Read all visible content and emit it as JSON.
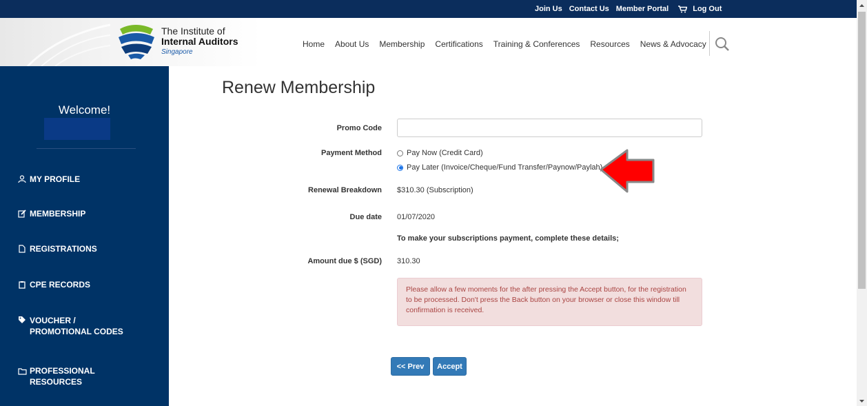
{
  "topbar": {
    "links": [
      "Join Us",
      "Contact Us",
      "Member Portal"
    ],
    "logout": "Log Out"
  },
  "logo": {
    "line1": "The Institute of",
    "line2": "Internal Auditors",
    "line3": "Singapore"
  },
  "nav": [
    "Home",
    "About Us",
    "Membership",
    "Certifications",
    "Training & Conferences",
    "Resources",
    "News & Advocacy"
  ],
  "sidebar": {
    "welcome": "Welcome!",
    "items": [
      {
        "label": "MY PROFILE",
        "icon": "user-icon"
      },
      {
        "label": "MEMBERSHIP",
        "icon": "edit-icon"
      },
      {
        "label": "REGISTRATIONS",
        "icon": "file-icon"
      },
      {
        "label": "CPE RECORDS",
        "icon": "clipboard-icon"
      },
      {
        "label_line1": "VOUCHER /",
        "label_line2": "PROMOTIONAL CODES",
        "icon": "tag-icon"
      },
      {
        "label_line1": "PROFESSIONAL",
        "label_line2": "RESOURCES",
        "icon": "folder-icon"
      }
    ]
  },
  "main": {
    "title": "Renew Membership",
    "promo_label": "Promo Code",
    "promo_value": "",
    "payment_label": "Payment Method",
    "payment_options": [
      {
        "label": "Pay Now (Credit Card)",
        "selected": false
      },
      {
        "label": "Pay Later (Invoice/Cheque/Fund Transfer/Paynow/Paylah)",
        "selected": true
      }
    ],
    "breakdown_label": "Renewal Breakdown",
    "breakdown_value": "$310.30 (Subscription)",
    "due_label": "Due date",
    "due_value": "01/07/2020",
    "instruction": "To make your subscriptions payment, complete these details;",
    "amount_label": "Amount due $ (SGD)",
    "amount_value": "310.30",
    "alert_text": "Please allow a few moments for the after pressing the Accept button, for the registration to be processed. Don't press the Back button on your browser or close this window till confirmation is received.",
    "prev_button": "<< Prev",
    "accept_button": "Accept"
  },
  "colors": {
    "navy": "#003366",
    "topbar": "#0b2d5c",
    "button": "#337ab7",
    "alert_bg": "#f2dede",
    "alert_text": "#a94442",
    "arrow": "#ff0000"
  }
}
